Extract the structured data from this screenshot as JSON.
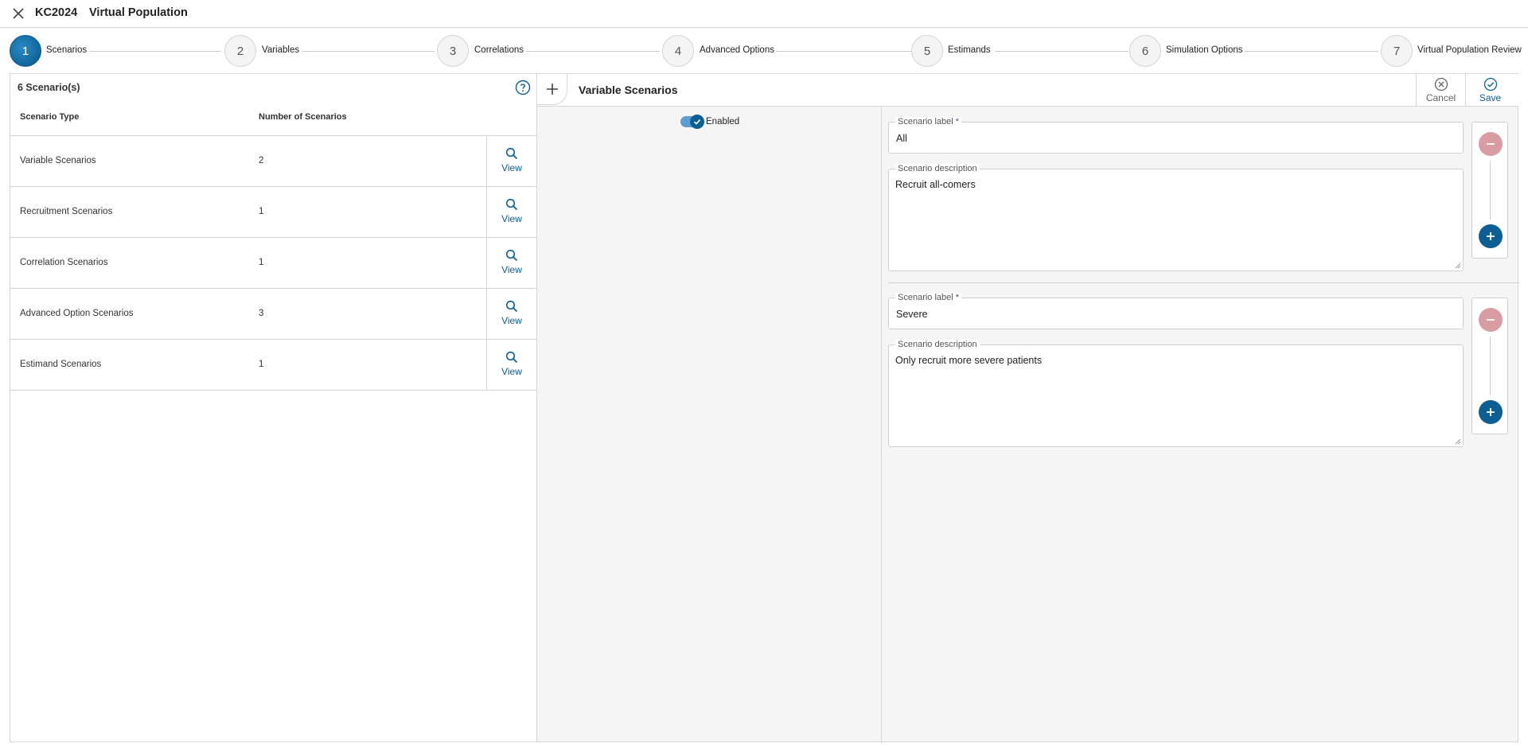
{
  "header": {
    "project_code": "KC2024",
    "title": "Virtual Population"
  },
  "stepper": {
    "steps": [
      {
        "number": "1",
        "label": "Scenarios",
        "active": true
      },
      {
        "number": "2",
        "label": "Variables",
        "active": false
      },
      {
        "number": "3",
        "label": "Correlations",
        "active": false
      },
      {
        "number": "4",
        "label": "Advanced Options",
        "active": false
      },
      {
        "number": "5",
        "label": "Estimands",
        "active": false
      },
      {
        "number": "6",
        "label": "Simulation Options",
        "active": false
      },
      {
        "number": "7",
        "label": "Virtual Population Review",
        "active": false
      }
    ]
  },
  "left_panel": {
    "title": "6 Scenario(s)",
    "columns": {
      "type": "Scenario Type",
      "count": "Number of Scenarios"
    },
    "view_label": "View",
    "rows": [
      {
        "type": "Variable Scenarios",
        "count": "2"
      },
      {
        "type": "Recruitment Scenarios",
        "count": "1"
      },
      {
        "type": "Correlation Scenarios",
        "count": "1"
      },
      {
        "type": "Advanced Option Scenarios",
        "count": "3"
      },
      {
        "type": "Estimand Scenarios",
        "count": "1"
      }
    ]
  },
  "right_panel": {
    "title": "Variable Scenarios",
    "cancel_label": "Cancel",
    "save_label": "Save",
    "enabled_label": "Enabled",
    "enabled": true,
    "label_field_label": "Scenario label",
    "required_mark": "*",
    "description_field_label": "Scenario description",
    "scenarios": [
      {
        "label": "All",
        "description": "Recruit all-comers"
      },
      {
        "label": "Severe",
        "description": "Only recruit more severe patients"
      }
    ]
  },
  "colors": {
    "accent": "#0d5f93",
    "remove_button": "#d99ca3",
    "toggle_track": "#5b9fd0",
    "panel_bg": "#f5f5f5",
    "border": "#d6d6d6"
  },
  "icons": {
    "close": "close-icon",
    "help": "help-circle-icon",
    "add": "plus-icon",
    "view": "search-icon",
    "cancel": "cancel-circle-icon",
    "save": "check-circle-icon",
    "remove_scenario": "minus-icon",
    "add_scenario": "plus-icon"
  }
}
